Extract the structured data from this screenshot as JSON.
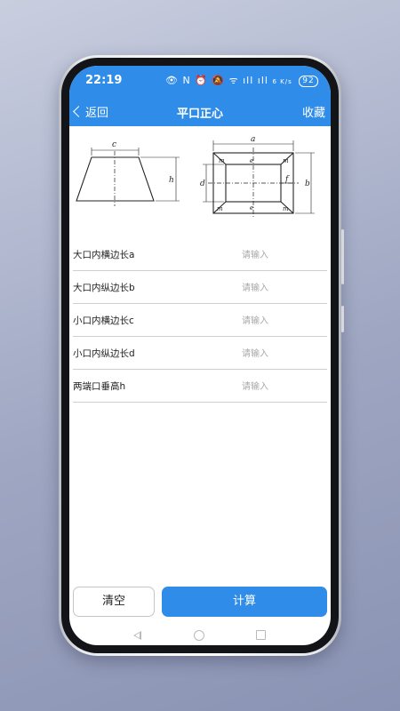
{
  "status_bar": {
    "time": "22:19",
    "icons_text": "👁 N ⏰ 🔕 ᯤ ıll ıll",
    "speed": "6 K/s",
    "battery": "92"
  },
  "nav": {
    "back_label": "返回",
    "title": "平口正心",
    "favorite_label": "收藏"
  },
  "diagram": {
    "labels": {
      "a": "a",
      "b": "b",
      "c": "c",
      "d": "d",
      "e": "e",
      "f": "f",
      "h": "h",
      "m": "m"
    }
  },
  "form": {
    "fields": [
      {
        "label": "大口内横边长a",
        "placeholder": "请输入"
      },
      {
        "label": "大口内纵边长b",
        "placeholder": "请输入"
      },
      {
        "label": "小口内横边长c",
        "placeholder": "请输入"
      },
      {
        "label": "小口内纵边长d",
        "placeholder": "请输入"
      },
      {
        "label": "两端口垂高h",
        "placeholder": "请输入"
      }
    ]
  },
  "actions": {
    "clear_label": "清空",
    "calculate_label": "计算"
  },
  "colors": {
    "accent": "#2f8ce8"
  }
}
